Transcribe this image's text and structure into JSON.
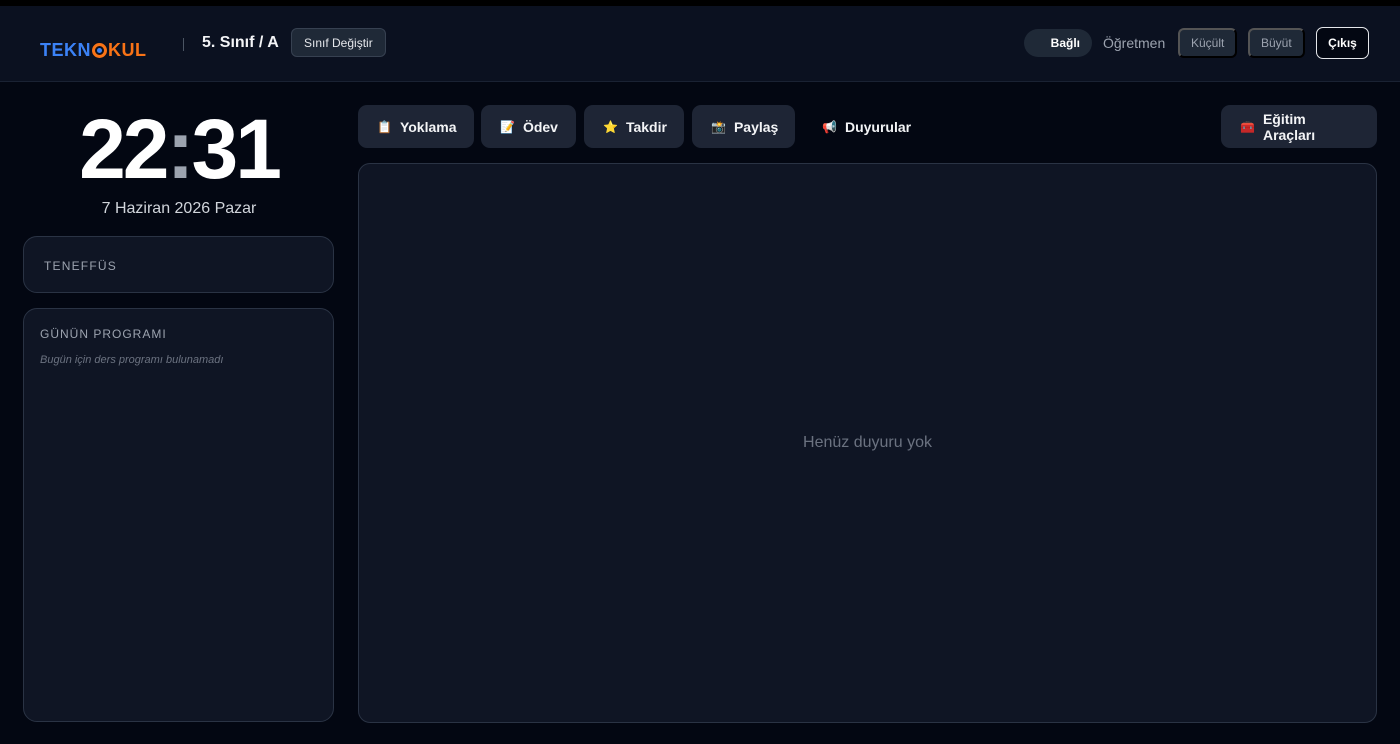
{
  "header": {
    "logo": {
      "part1": "TEKN",
      "part2": "KUL"
    },
    "class_name": "5. Sınıf / A",
    "change_class_label": "Sınıf Değiştir",
    "connection_status": "Bağlı",
    "role": "Öğretmen",
    "shrink_label": "Küçült",
    "grow_label": "Büyüt",
    "logout_label": "Çıkış"
  },
  "clock": {
    "hours": "22",
    "separator": ":",
    "minutes": "31"
  },
  "date": "7 Haziran 2026 Pazar",
  "break_card": {
    "title": "TENEFFÜS"
  },
  "program_card": {
    "title": "GÜNÜN PROGRAMI",
    "empty_text": "Bugün için ders programı bulunamadı"
  },
  "tabs": [
    {
      "icon": "📋",
      "icon_name": "clipboard-icon",
      "label": "Yoklama"
    },
    {
      "icon": "📝",
      "icon_name": "memo-icon",
      "label": "Ödev"
    },
    {
      "icon": "⭐",
      "icon_name": "star-icon",
      "label": "Takdir"
    },
    {
      "icon": "📸",
      "icon_name": "camera-icon",
      "label": "Paylaş"
    },
    {
      "icon": "📢",
      "icon_name": "megaphone-icon",
      "label": "Duyurular",
      "active": true
    },
    {
      "icon": "🧰",
      "icon_name": "toolbox-icon",
      "label": "Eğitim Araçları"
    }
  ],
  "main_panel": {
    "empty_text": "Henüz duyuru yok"
  },
  "colors": {
    "background": "#030712",
    "panel": "#0f1524",
    "logo_blue": "#3b82f6",
    "logo_orange": "#f97316"
  }
}
